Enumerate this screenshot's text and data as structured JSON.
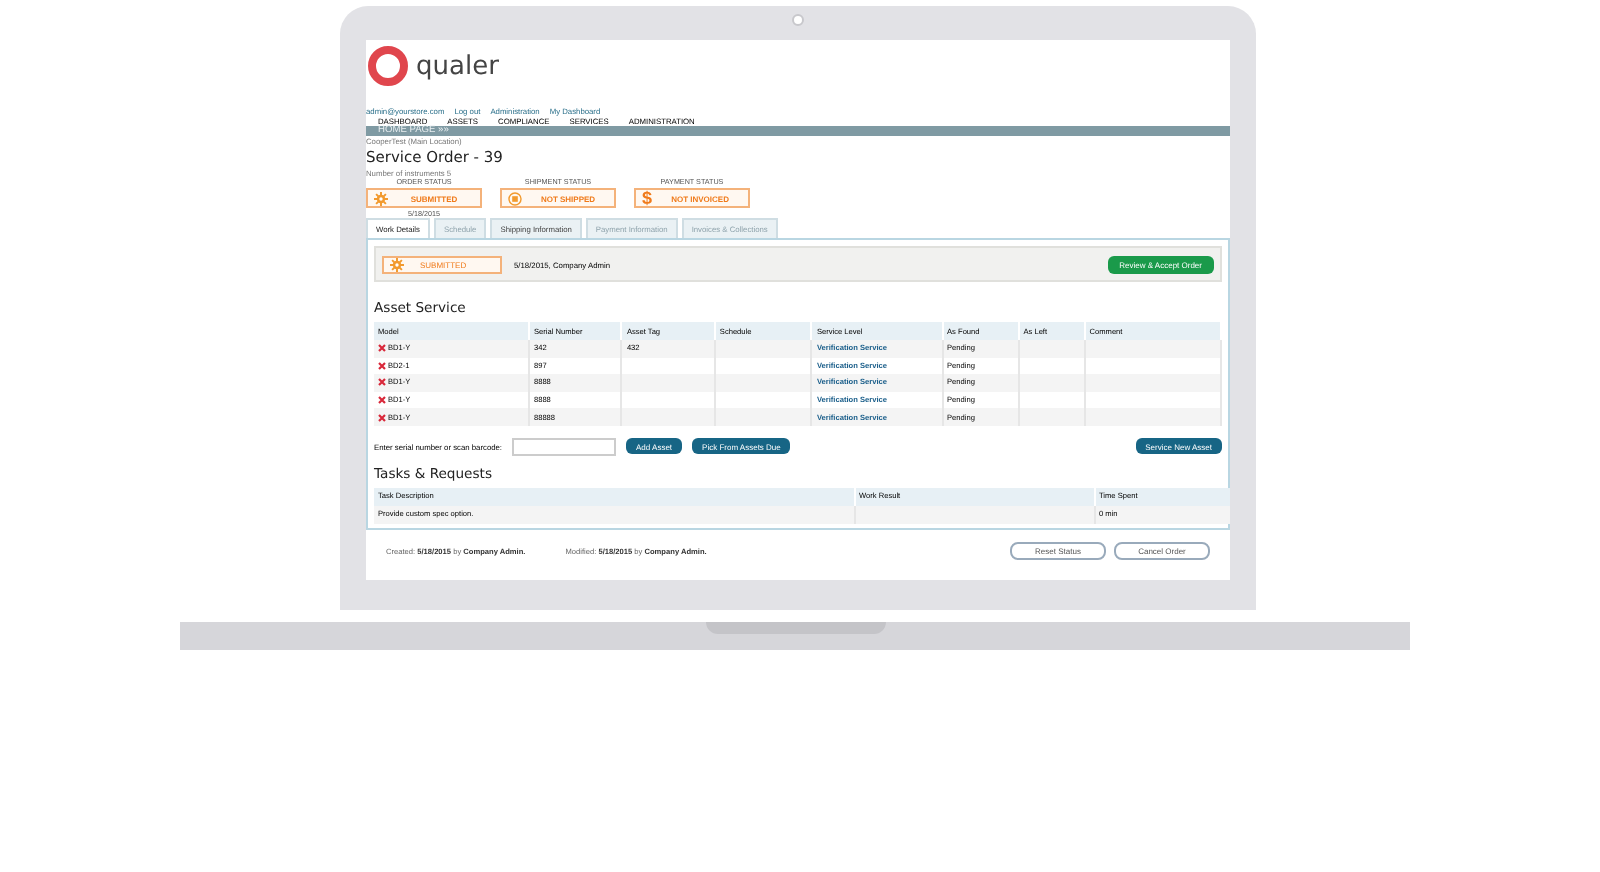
{
  "header": {
    "logo": "qualer",
    "links": [
      "admin@yourstore.com",
      "Log out",
      "Administration",
      "My Dashboard"
    ]
  },
  "nav": {
    "items": [
      "DASHBOARD",
      "ASSETS",
      "COMPLIANCE",
      "SERVICES",
      "ADMINISTRATION"
    ],
    "home": "HOME PAGE »»"
  },
  "order": {
    "location": "CooperTest (Main Location)",
    "title": "Service Order - 39",
    "instruments": "Number of instruments 5",
    "statuses": [
      {
        "label": "ORDER STATUS",
        "value": "SUBMITTED",
        "kind": "gear",
        "date": "5/18/2015"
      },
      {
        "label": "SHIPMENT STATUS",
        "value": "NOT SHIPPED",
        "kind": "box"
      },
      {
        "label": "PAYMENT STATUS",
        "value": "NOT INVOICED",
        "kind": "dollar",
        "icon": "$"
      }
    ]
  },
  "tabs": [
    {
      "label": "Work Details",
      "selected": true,
      "disabled": false
    },
    {
      "label": "Schedule",
      "selected": false,
      "disabled": true
    },
    {
      "label": "Shipping Information",
      "selected": false,
      "disabled": false
    },
    {
      "label": "Payment Information",
      "selected": false,
      "disabled": true
    },
    {
      "label": "Invoices & Collections",
      "selected": false,
      "disabled": true
    }
  ],
  "status_bar": {
    "value": "SUBMITTED",
    "note": "5/18/2015, Company Admin",
    "button": "Review & Accept Order"
  },
  "asset_service": {
    "title": "Asset Service",
    "columns": [
      "Model",
      "Serial Number",
      "Asset Tag",
      "Schedule",
      "Service Level",
      "As Found",
      "As Left",
      "Comment"
    ],
    "rows": [
      {
        "model": "BD1-Y",
        "serial": "342",
        "asset_tag": "432",
        "service_level": "Verification Service",
        "as_found": "Pending"
      },
      {
        "model": "BD2-1",
        "serial": "897",
        "service_level": "Verification Service",
        "as_found": "Pending"
      },
      {
        "model": "BD1-Y",
        "serial": "8888",
        "service_level": "Verification Service",
        "as_found": "Pending"
      },
      {
        "model": "BD1-Y",
        "serial": "8888",
        "service_level": "Verification Service",
        "as_found": "Pending"
      },
      {
        "model": "BD1-Y",
        "serial": "88888",
        "service_level": "Verification Service",
        "as_found": "Pending"
      }
    ]
  },
  "serial_entry": {
    "label": "Enter serial number or scan barcode:",
    "buttons": [
      "Add Asset",
      "Pick From Assets Due"
    ],
    "new_button": "Service New Asset"
  },
  "tasks": {
    "title": "Tasks & Requests",
    "columns": [
      "Task Description",
      "Work Result",
      "Time Spent"
    ],
    "rows": [
      {
        "description": "Provide custom spec option.",
        "time_spent": "0 min"
      }
    ]
  },
  "footer": {
    "created": "Created: **5/18/2015** by **Company Admin.**",
    "modified": "Modified: **5/18/2015** by **Company Admin.**",
    "buttons": [
      "Reset Status",
      "Cancel Order"
    ]
  }
}
